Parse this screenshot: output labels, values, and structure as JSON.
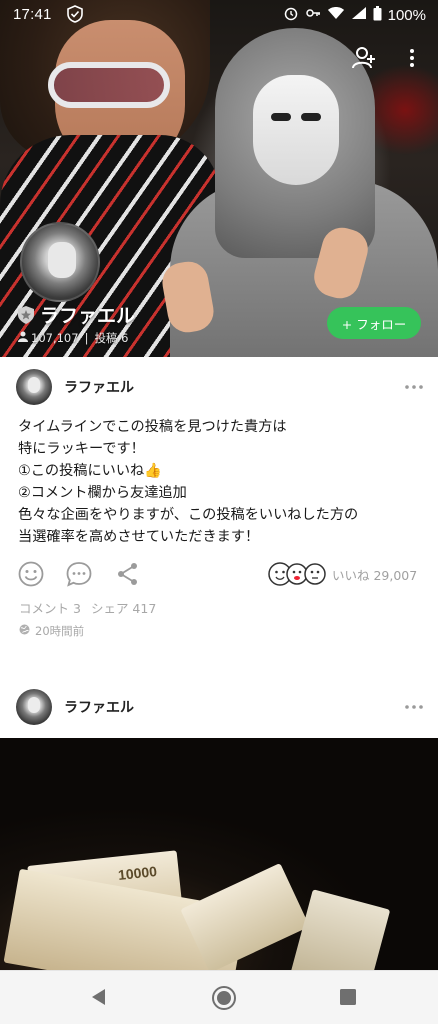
{
  "status_bar": {
    "time": "17:41",
    "battery": "100%"
  },
  "profile": {
    "name": "ラファエル",
    "followers": "107,107",
    "separator": "|",
    "posts_label": "投稿 6",
    "follow_button": "+ フォロー"
  },
  "posts": [
    {
      "author": "ラファエル",
      "lines": [
        "タイムラインでこの投稿を見つけた貴方は",
        "特にラッキーです！",
        "①この投稿にいいね👍",
        "②コメント欄から友達追加",
        "色々な企画をやりますが、この投稿をいいねした方の",
        "当選確率を高めさせていただきます！"
      ],
      "likes": "いいね 29,007",
      "comments": "コメント 3",
      "shares": "シェア 417",
      "time": "20時間前"
    },
    {
      "author": "ラファエル",
      "image_text": "10000"
    }
  ],
  "icons": {
    "add_friend": "add-friend-icon",
    "more": "more-vert-icon",
    "like": "smiley-icon",
    "comment": "comment-bubble-icon",
    "share": "share-icon"
  },
  "colors": {
    "follow_green": "#36c35a",
    "muted_text": "#a8a8a8"
  }
}
